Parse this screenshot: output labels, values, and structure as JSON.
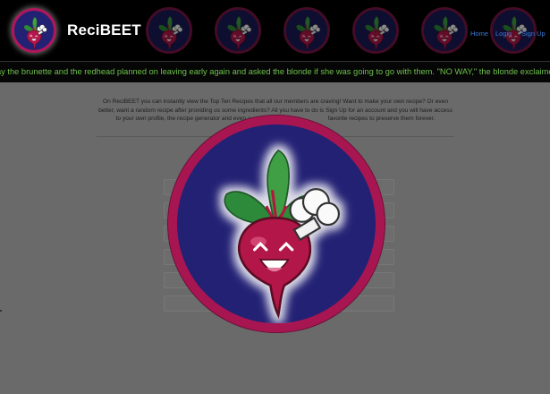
{
  "brand": {
    "name": "ReciBEET",
    "logo_icon": "beet-chef-icon"
  },
  "nav": {
    "links": [
      {
        "label": "Home"
      },
      {
        "label": "Login"
      },
      {
        "label": "Sign Up"
      }
    ],
    "link_color": "#3d7bd6"
  },
  "marquee": {
    "text": "ay the brunette and the redhead planned on leaving early again and asked the blonde if she was going to go with them. \"NO WAY,\" the blonde exclaimed, \" I ALMOST GOT CAUGHT",
    "color": "#6ec24c"
  },
  "intro": {
    "text": "On ReciBEET you can instantly view the Top Ten Recipes that all our members are craving! Want to make your own recipe? Or even better, want a random recipe after providing us some ingredients? All you have to do is Sign Up for an account and you will have access to your own profile, the recipe generator and even a s",
    "text_tail": " favorite recipes to preserve them forever.",
    "line_cut": "Ch"
  },
  "colors": {
    "logo_bg": "#232174",
    "logo_ring": "#a81651",
    "overlay": "#6a6a6a"
  }
}
